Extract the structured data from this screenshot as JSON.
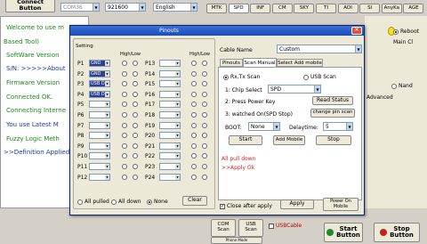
{
  "toolbar": {
    "connect_label": "Connect\nButton",
    "port_value": "COM36",
    "baud_value": "921600",
    "language_value": "English"
  },
  "model_tabs": [
    "MTK",
    "SPD",
    "INF",
    "CM",
    "SKY",
    "TI",
    "ADI",
    "SI",
    "AnyKa",
    "AGE"
  ],
  "log_lines": [
    "Welcome to use m",
    "Based Tool)",
    "SoftWare Version",
    "S/N: >>>>>About",
    "Firmware Version",
    "Connected OK.",
    "Connecting Interne",
    "You use Latest M",
    "Fuzzy Logic Meth",
    ">>Definition Applied"
  ],
  "right_panel": {
    "radio_label": "Nand",
    "advanced_label": "Advanced",
    "reboot_label": "Reboot",
    "main_cl_label": "Main Cl"
  },
  "bottom": {
    "com_scan": "COM\nScan",
    "usb_scan": "USB\nScan",
    "usb_cable": "USBCable",
    "start_label": "Start\nButton",
    "stop_label": "Stop\nButton",
    "small_btn": "Phone Mode"
  },
  "dialog": {
    "title": "Pinouts",
    "setting_label": "Setting",
    "high_low_left": "High/Low",
    "high_low_right": "High/Low",
    "pins_left": [
      {
        "label": "P1",
        "value": "GND",
        "filled": true
      },
      {
        "label": "P2",
        "value": "GND",
        "filled": true
      },
      {
        "label": "P3",
        "value": "USB D+",
        "filled": true
      },
      {
        "label": "P4",
        "value": "USB D-",
        "filled": true
      },
      {
        "label": "P5",
        "value": "",
        "filled": false
      },
      {
        "label": "P6",
        "value": "",
        "filled": false
      },
      {
        "label": "P7",
        "value": "",
        "filled": false
      },
      {
        "label": "P8",
        "value": "",
        "filled": false
      },
      {
        "label": "P9",
        "value": "",
        "filled": false
      },
      {
        "label": "P10",
        "value": "",
        "filled": false
      },
      {
        "label": "P11",
        "value": "",
        "filled": false
      },
      {
        "label": "P12",
        "value": "",
        "filled": false
      }
    ],
    "pins_right": [
      {
        "label": "P13"
      },
      {
        "label": "P14"
      },
      {
        "label": "P15"
      },
      {
        "label": "P16"
      },
      {
        "label": "P17"
      },
      {
        "label": "P18"
      },
      {
        "label": "P19"
      },
      {
        "label": "P20"
      },
      {
        "label": "P21"
      },
      {
        "label": "P22"
      },
      {
        "label": "P23"
      },
      {
        "label": "P24"
      }
    ],
    "clear_label": "Clear",
    "all_pulled": "All pulled",
    "all_down": "All down",
    "none_label": "None",
    "cable_name_label": "Cable Name",
    "cable_name_value": "Custom",
    "tabs": [
      "Pinouts",
      "Scan Manual",
      "Select Add mobile"
    ],
    "rx_tx_scan": "Rx,Tx Scan",
    "usb_scan": "USB Scan",
    "step1": "1: Chip Select",
    "chip_value": "SPD",
    "step2": "2: Press Power Key",
    "read_status": "Read Status",
    "step3": "3: watched On(SPD Stop)",
    "change_pin": "change pin scan",
    "boot_label": "BOOT:",
    "boot_value": "None",
    "delay_label": "Delaytime:",
    "delay_value": "5",
    "start_btn": "Start",
    "add_mobile_btn": "Add Mobile",
    "stop_btn": "Stop",
    "status_line1": "All pull down",
    "status_line2": ">>Apply Ok",
    "close_after_apply": "Close after apply",
    "apply_btn": "Apply",
    "power_on_btn": "Power On\nMobile"
  }
}
